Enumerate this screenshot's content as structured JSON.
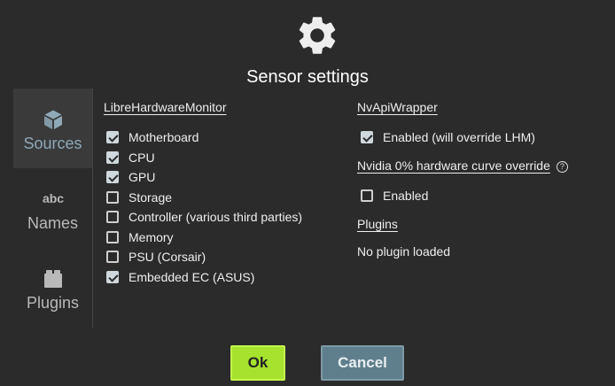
{
  "dialog": {
    "title": "Sensor settings",
    "header_icon": "gear-icon"
  },
  "sidebar": {
    "items": [
      {
        "label": "Sources",
        "icon": "cube-icon",
        "active": true
      },
      {
        "label": "Names",
        "icon": "abc-icon",
        "active": false
      },
      {
        "label": "Plugins",
        "icon": "puzzle-icon",
        "active": false
      }
    ]
  },
  "lhm": {
    "title": "LibreHardwareMonitor",
    "options": [
      {
        "label": "Motherboard",
        "checked": true
      },
      {
        "label": "CPU",
        "checked": true
      },
      {
        "label": "GPU",
        "checked": true
      },
      {
        "label": "Storage",
        "checked": false
      },
      {
        "label": "Controller (various third parties)",
        "checked": false
      },
      {
        "label": "Memory",
        "checked": false
      },
      {
        "label": "PSU (Corsair)",
        "checked": false
      },
      {
        "label": "Embedded EC (ASUS)",
        "checked": true
      }
    ]
  },
  "nvapi": {
    "title": "NvApiWrapper",
    "enabled_label": "Enabled (will override LHM)",
    "enabled_checked": true
  },
  "nvidia_curve": {
    "title": "Nvidia 0% hardware curve override",
    "help_icon": "?",
    "enabled_label": "Enabled",
    "enabled_checked": false
  },
  "plugins": {
    "title": "Plugins",
    "status": "No plugin loaded"
  },
  "buttons": {
    "ok": "Ok",
    "cancel": "Cancel"
  },
  "colors": {
    "background": "#2b2b2b",
    "ok_button": "#a6e22e",
    "cancel_button": "#5f7f8c",
    "active_tab_text": "#8fa9b8"
  }
}
